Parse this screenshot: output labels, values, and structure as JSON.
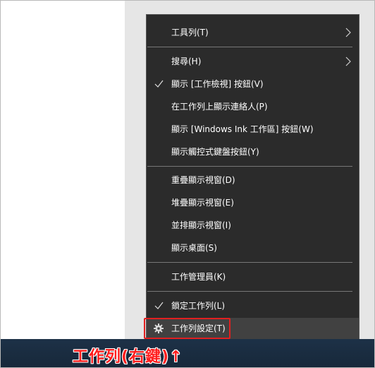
{
  "menu": {
    "items": [
      {
        "label": "工具列(T)",
        "submenu": true
      },
      {
        "label": "搜尋(H)",
        "submenu": true
      },
      {
        "label": "顯示 [工作檢視] 按鈕(V)",
        "checked": true
      },
      {
        "label": "在工作列上顯示連絡人(P)"
      },
      {
        "label": "顯示 [Windows Ink 工作區] 按鈕(W)"
      },
      {
        "label": "顯示觸控式鍵盤按鈕(Y)"
      },
      {
        "label": "重疊顯示視窗(D)"
      },
      {
        "label": "堆疊顯示視窗(E)"
      },
      {
        "label": "並排顯示視窗(I)"
      },
      {
        "label": "顯示桌面(S)"
      },
      {
        "label": "工作管理員(K)"
      },
      {
        "label": "鎖定工作列(L)",
        "checked": true
      },
      {
        "label": "工作列設定(T)",
        "icon": "gear-icon"
      }
    ]
  },
  "annotation": {
    "caption": "工作列(右鍵)↑",
    "highlight_color": "#e02020"
  },
  "colors": {
    "menu_bg": "#2b2b2b",
    "taskbar": "#1d3147",
    "caption": "#ff1e1e"
  }
}
